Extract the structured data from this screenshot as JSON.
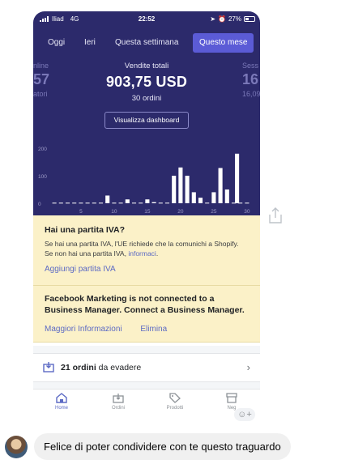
{
  "status_bar": {
    "carrier": "Iliad",
    "network": "4G",
    "time": "22:52",
    "battery": "27%"
  },
  "tabs": [
    {
      "label": "Oggi",
      "active": false
    },
    {
      "label": "Ieri",
      "active": false
    },
    {
      "label": "Questa settimana",
      "active": false
    },
    {
      "label": "Questo mese",
      "active": true
    }
  ],
  "kpi_left": {
    "label": "nline",
    "value": "57",
    "sub": "atori"
  },
  "kpi_main": {
    "label": "Vendite totali",
    "value": "903,75 USD",
    "sub": "30 ordini"
  },
  "kpi_right": {
    "label": "Sess",
    "value": "16",
    "sub": "16,09"
  },
  "dashboard_button": "Visualizza dashboard",
  "chart_data": {
    "type": "bar",
    "x": [
      1,
      2,
      3,
      4,
      5,
      6,
      7,
      8,
      9,
      10,
      11,
      12,
      13,
      14,
      15,
      16,
      17,
      18,
      19,
      20,
      21,
      22,
      23,
      24,
      25,
      26,
      27,
      28,
      29,
      30
    ],
    "values": [
      2,
      2,
      2,
      2,
      2,
      2,
      2,
      2,
      28,
      2,
      2,
      14,
      2,
      2,
      14,
      4,
      2,
      2,
      100,
      130,
      100,
      40,
      20,
      2,
      40,
      128,
      50,
      2,
      2,
      2
    ],
    "last_bar": {
      "x": 28.5,
      "value": 180
    },
    "yticks": [
      "200",
      "100",
      "0"
    ],
    "ylim": [
      0,
      200
    ],
    "xticks": [
      "5",
      "10",
      "15",
      "20",
      "25",
      "30"
    ],
    "xtick_values": [
      5,
      10,
      15,
      20,
      25,
      30
    ],
    "colors": {
      "bar": "#ffffff",
      "background": "#2c2a6b",
      "axis": "#9e9cc8"
    }
  },
  "iva_card": {
    "title": "Hai una partita IVA?",
    "body": "Se hai una partita IVA, l'UE richiede che la comunichi a Shopify. Se non hai una partita IVA,",
    "body_link": "informaci",
    "body_end": ".",
    "action": "Aggiungi partita IVA"
  },
  "fb_card": {
    "title": "Facebook Marketing is not connected to a Business Manager. Connect a Business Manager.",
    "action_more": "Maggiori Informazioni",
    "action_remove": "Elimina"
  },
  "orders_row": {
    "count": "21 ordini",
    "suffix": " da evadere"
  },
  "bottom_nav": [
    {
      "label": "Home",
      "icon": "home-icon",
      "active": true
    },
    {
      "label": "Ordini",
      "icon": "orders-icon",
      "active": false
    },
    {
      "label": "Prodotti",
      "icon": "tag-icon",
      "active": false
    },
    {
      "label": "Neg",
      "icon": "store-icon",
      "active": false
    }
  ],
  "message": {
    "text": "Felice di poter condividere con te questo traguardo"
  },
  "colors": {
    "header": "#2c2a6b",
    "accent": "#5c6ac4",
    "banner": "#fbf1c8",
    "bubble": "#f0f0f0"
  }
}
